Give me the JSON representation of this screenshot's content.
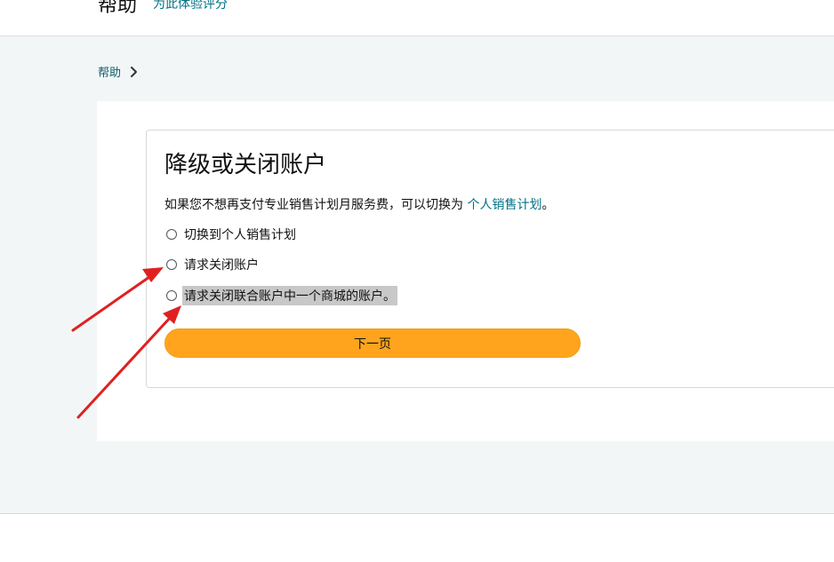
{
  "header": {
    "title": "帮助",
    "rate_link": "为此体验评分"
  },
  "breadcrumb": {
    "home": "帮助"
  },
  "card": {
    "title": "降级或关闭账户",
    "desc_prefix": "如果您不想再支付专业销售计划月服务费，可以切换为 ",
    "desc_link": "个人销售计划",
    "desc_suffix": "。",
    "options": [
      {
        "label": "切换到个人销售计划",
        "selected": false
      },
      {
        "label": "请求关闭账户",
        "selected": false
      },
      {
        "label": "请求关闭联合账户中一个商城的账户。",
        "selected": false
      }
    ],
    "next_label": "下一页"
  },
  "colors": {
    "accent_button": "#ffa41c",
    "link": "#007185",
    "annotation_arrow": "#e02020",
    "background": "#f3f6f6"
  }
}
